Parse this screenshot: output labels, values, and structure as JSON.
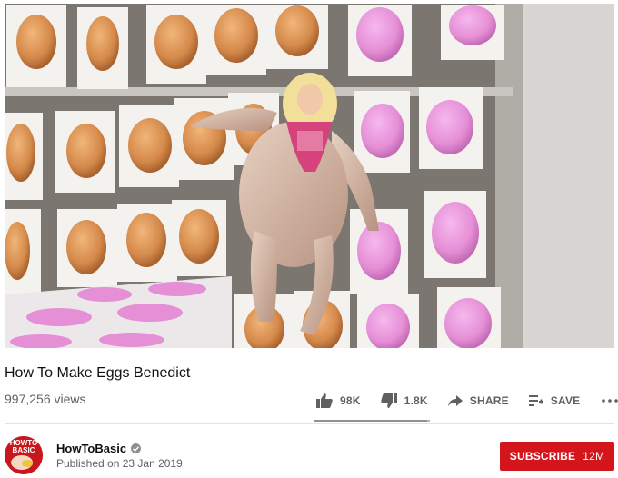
{
  "video": {
    "title": "How To Make Eggs Benedict",
    "views": "997,256 views"
  },
  "actions": {
    "likes": "98K",
    "dislikes": "1.8K",
    "share_label": "SHARE",
    "save_label": "SAVE",
    "like_ratio": 0.98
  },
  "channel": {
    "name": "HowToBasic",
    "published": "Published on 23 Jan 2019",
    "avatar_text_top": "HOWTO",
    "avatar_text_bottom": "BASIC",
    "subscribe_label": "SUBSCRIBE",
    "subscriber_count": "12M"
  },
  "colors": {
    "subscribe": "#d4151c",
    "egg_brown": "#d4894a",
    "egg_pink": "#e58fd6"
  },
  "icons": [
    "thumbs-up-icon",
    "thumbs-down-icon",
    "share-icon",
    "save-playlist-icon",
    "more-icon",
    "verified-icon"
  ]
}
